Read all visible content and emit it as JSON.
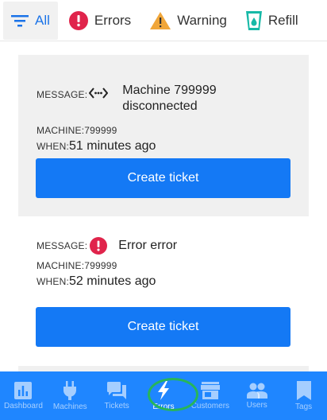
{
  "tabs": [
    {
      "label": "All",
      "icon": "filter-icon",
      "active": true
    },
    {
      "label": "Errors",
      "icon": "error-icon"
    },
    {
      "label": "Warning",
      "icon": "warning-icon"
    },
    {
      "label": "Refill",
      "icon": "refill-icon"
    }
  ],
  "cards": [
    {
      "message_key": "MESSAGE:",
      "message_icon": "disconnected-icon",
      "message_line1": "Machine 799999",
      "message_line2": "disconnected",
      "machine_key": "MACHINE:",
      "machine_value": "799999",
      "when_key": "WHEN:",
      "when_value": "51 minutes ago",
      "button": "Create ticket"
    },
    {
      "message_key": "MESSAGE:",
      "message_icon": "error-icon",
      "message_line1": "Error error",
      "machine_key": "MACHINE:",
      "machine_value": "799999",
      "when_key": "WHEN:",
      "when_value": "52 minutes ago",
      "button": "Create ticket"
    }
  ],
  "nav": [
    {
      "label": "Dashboard",
      "icon": "dashboard-icon"
    },
    {
      "label": "Machines",
      "icon": "plug-icon"
    },
    {
      "label": "Tickets",
      "icon": "chat-icon"
    },
    {
      "label": "Errors",
      "icon": "lightning-icon",
      "active": true
    },
    {
      "label": "Customers",
      "icon": "store-icon"
    },
    {
      "label": "Users",
      "icon": "people-icon"
    },
    {
      "label": "Tags",
      "icon": "bookmark-icon"
    }
  ],
  "colors": {
    "accent": "#1479f5",
    "nav_bg": "#1f86ff",
    "error": "#e0244b",
    "warning": "#f0a63a",
    "refill": "#17b9a7",
    "highlight_ring": "#27b55a"
  }
}
